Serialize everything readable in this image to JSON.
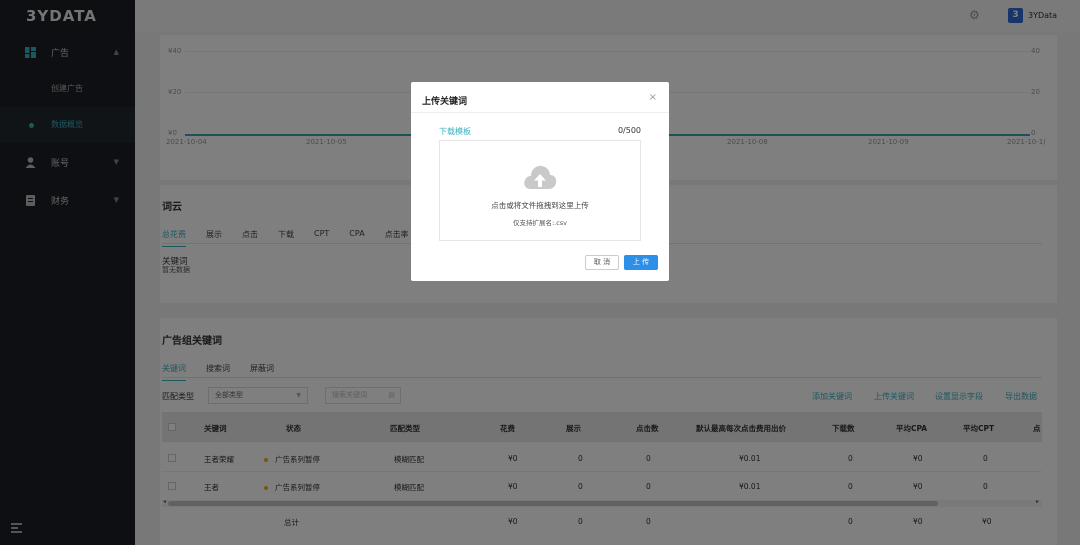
{
  "app": {
    "logo": "3YDATA",
    "brand_name": "3YData",
    "brand_badge": "3"
  },
  "sidebar": {
    "groups": [
      {
        "label": "广告",
        "icon": "grid-icon",
        "expanded": true,
        "items": [
          "创建广告",
          "数据概览"
        ],
        "active_item": "数据概览"
      },
      {
        "label": "账号",
        "icon": "user-icon",
        "expanded": false
      },
      {
        "label": "财务",
        "icon": "ledger-icon",
        "expanded": false
      }
    ]
  },
  "chart": {
    "y_left_ticks": [
      "¥40",
      "¥20",
      "¥0"
    ],
    "y_right_ticks": [
      "40",
      "20",
      "0"
    ],
    "x_ticks": [
      "2021-10-04",
      "2021-10-05",
      "2021-10-08",
      "2021-10-09",
      "2021-10-1("
    ]
  },
  "word_cloud": {
    "title": "词云",
    "tabs": [
      "总花费",
      "展示",
      "点击",
      "下载",
      "CPT",
      "CPA",
      "点击率"
    ],
    "active_tab": "总花费",
    "kw_label": "关键词",
    "empty_text": "暂无数据"
  },
  "keywords_panel": {
    "title": "广告组关键词",
    "tabs": [
      "关键词",
      "搜索词",
      "屏蔽词"
    ],
    "active_tab": "关键词",
    "match_type_label": "匹配类型",
    "match_type_value": "全部类型",
    "search_placeholder": "搜索关键词",
    "actions": [
      "添加关键词",
      "上传关键词",
      "设置显示字段",
      "导出数据"
    ],
    "columns": [
      "关键词",
      "状态",
      "匹配类型",
      "花费",
      "展示",
      "点击数",
      "默认最高每次点击费用出价",
      "下载数",
      "平均CPA",
      "平均CPT",
      "点"
    ],
    "rows": [
      [
        "王者荣耀",
        "广告系列暂停",
        "模糊匹配",
        "¥0",
        "0",
        "0",
        "¥0.01",
        "0",
        "¥0",
        "0"
      ],
      [
        "王者",
        "广告系列暂停",
        "模糊匹配",
        "¥0",
        "0",
        "0",
        "¥0.01",
        "0",
        "¥0",
        "0"
      ]
    ],
    "total": [
      "总计",
      "¥0",
      "0",
      "0",
      "0",
      "¥0",
      "¥0"
    ]
  },
  "modal": {
    "title": "上传关键词",
    "close": "×",
    "template_link": "下载模板",
    "count": "0/500",
    "drop_hint": "点击或将文件拖拽到这里上传",
    "drop_sub": "仅支持扩展名:.csv",
    "cancel": "取 消",
    "upload": "上 传"
  },
  "colors": {
    "accent": "#39b0c0",
    "primary_button": "#2d8fe8",
    "sidebar_bg": "#1c1f24",
    "status_paused": "#e8b417"
  }
}
